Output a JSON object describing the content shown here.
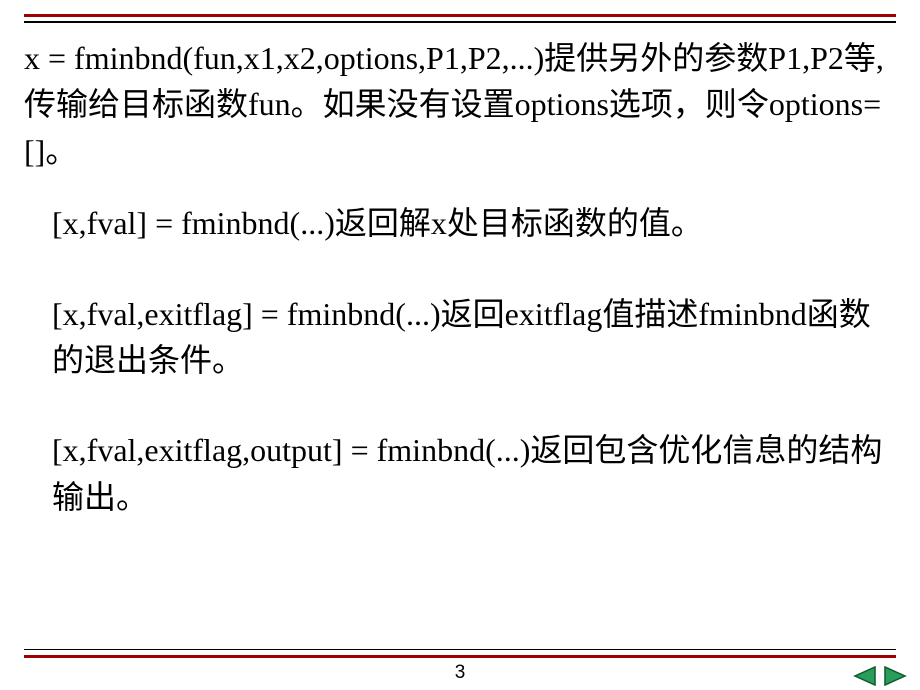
{
  "paragraphs": {
    "p1": "x = fminbnd(fun,x1,x2,options,P1,P2,...)提供另外的参数P1,P2等,传输给目标函数fun。如果没有设置options选项，则令options=[]。",
    "p2": "[x,fval] = fminbnd(...)返回解x处目标函数的值。",
    "p3": "[x,fval,exitflag] = fminbnd(...)返回exitflag值描述fminbnd函数的退出条件。",
    "p4": "[x,fval,exitflag,output] = fminbnd(...)返回包含优化信息的结构输出。"
  },
  "page_number": "3",
  "colors": {
    "accent_red": "#a00000",
    "nav_green": "#2a9d5a",
    "nav_stroke": "#0b5c2e"
  }
}
